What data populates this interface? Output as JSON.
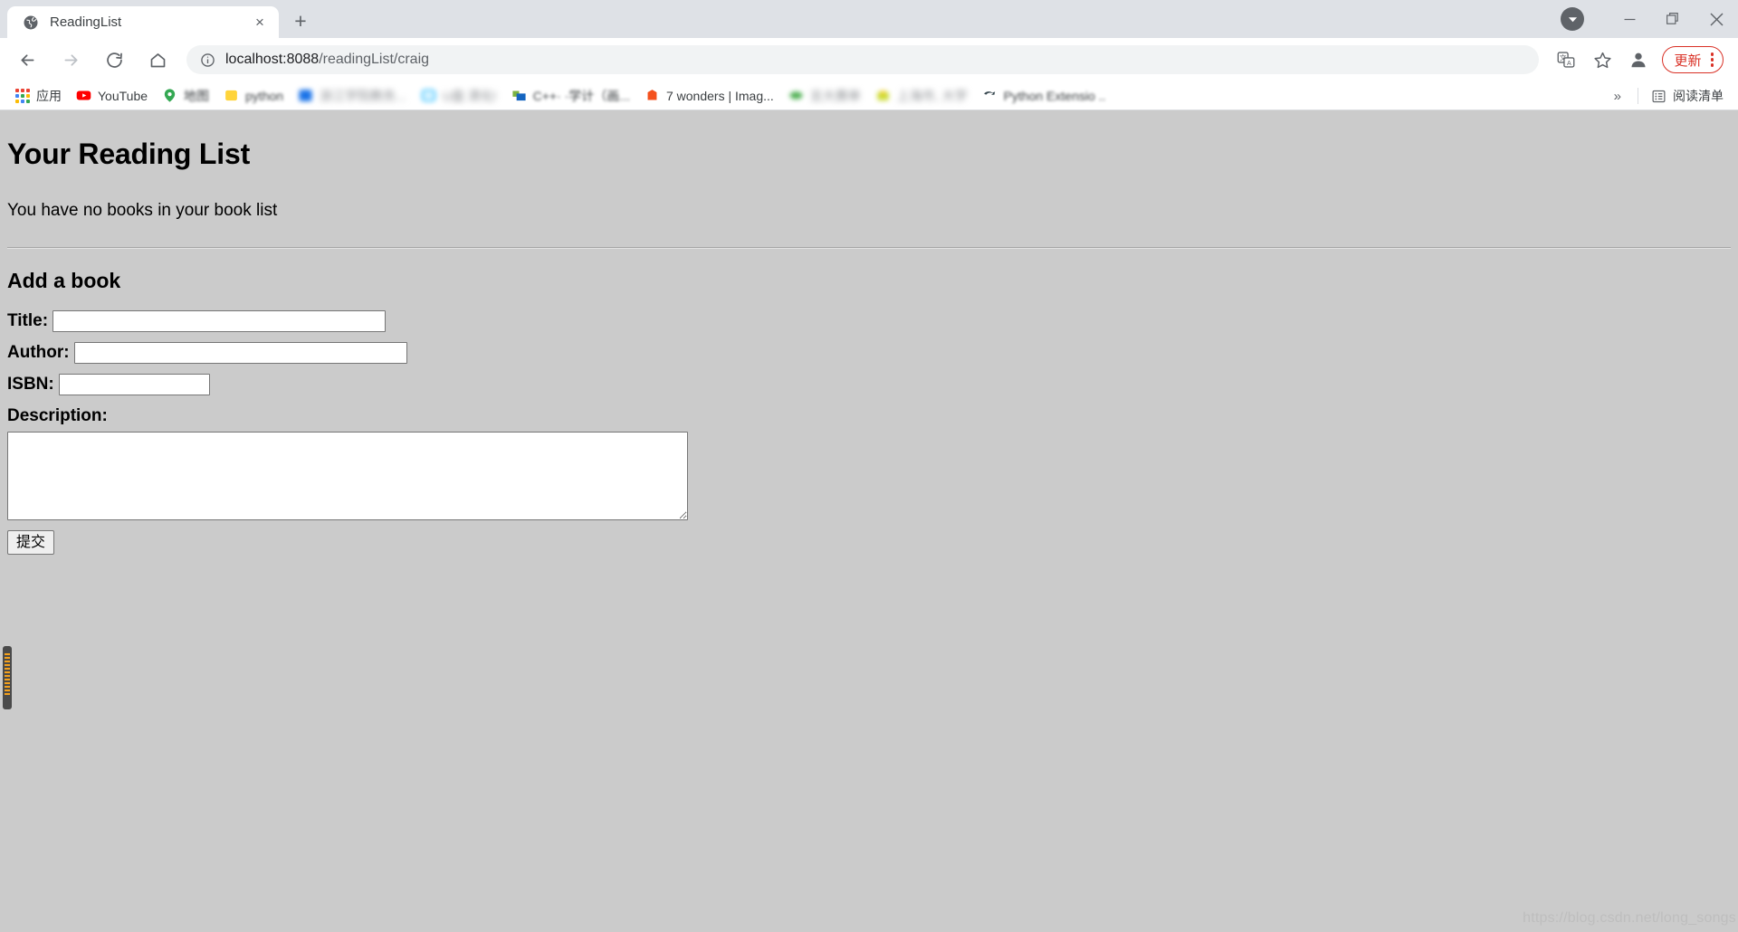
{
  "browser": {
    "tab": {
      "title": "ReadingList",
      "favicon": "globe-icon",
      "close_label": "×"
    },
    "new_tab_label": "+",
    "window_controls": {
      "download_indicator": "download-badge-icon",
      "minimize": "—",
      "maximize": "□",
      "close": "✕"
    },
    "toolbar": {
      "back": "←",
      "forward": "→",
      "reload": "↻",
      "home": "⌂",
      "site_info": "ⓘ",
      "url_host": "localhost:8088",
      "url_path": "/readingList/craig",
      "url_full": "localhost:8088/readingList/craig",
      "translate_icon": "translate-icon",
      "bookmark_star": "☆",
      "profile_avatar": "profile-avatar-icon",
      "update_label": "更新",
      "menu": "kebab-menu-icon"
    },
    "bookmarks": {
      "apps_label": "应用",
      "items": [
        {
          "label": "YouTube",
          "icon_color": "#ff0000",
          "blur": "none"
        },
        {
          "label": "地图",
          "icon_color": "#34a853",
          "blur": "semi"
        },
        {
          "label": "python",
          "icon_color": "#ffd43b",
          "blur": "semi"
        },
        {
          "label": "浙江学院教务...",
          "icon_color": "#1a73e8",
          "blur": "full"
        },
        {
          "label": "U盘 清化!",
          "icon_color": "#00b0ff",
          "blur": "full"
        },
        {
          "label": "C++· ·学计（画...",
          "icon_color": "#0f7dc2",
          "blur": "semi"
        },
        {
          "label": "7 wonders | Imag...",
          "icon_color": "#f4511e",
          "blur": "none"
        },
        {
          "label": "言大赛单",
          "icon_color": "#4caf50",
          "blur": "full"
        },
        {
          "label": "上海市, 大学",
          "icon_color": "#cddc39",
          "blur": "full"
        },
        {
          "label": "Python Extensio ..",
          "icon_color": "#3d4c57",
          "blur": "semi"
        }
      ],
      "overflow_label": "»",
      "reading_list_label": "阅读清单",
      "reading_list_icon": "reading-list-icon"
    }
  },
  "page": {
    "heading": "Your Reading List",
    "empty_message": "You have no books in your book list",
    "form_heading": "Add a book",
    "fields": [
      {
        "label": "Title:",
        "value": "",
        "placeholder": "",
        "width_class": "w-title"
      },
      {
        "label": "Author:",
        "value": "",
        "placeholder": "",
        "width_class": "w-author"
      },
      {
        "label": "ISBN:",
        "value": "",
        "placeholder": "",
        "width_class": "w-isbn"
      }
    ],
    "description_label": "Description:",
    "description_value": "",
    "submit_label": "提交",
    "background_color": "#cbcbcb"
  },
  "watermark": "https://blog.csdn.net/long_songs"
}
